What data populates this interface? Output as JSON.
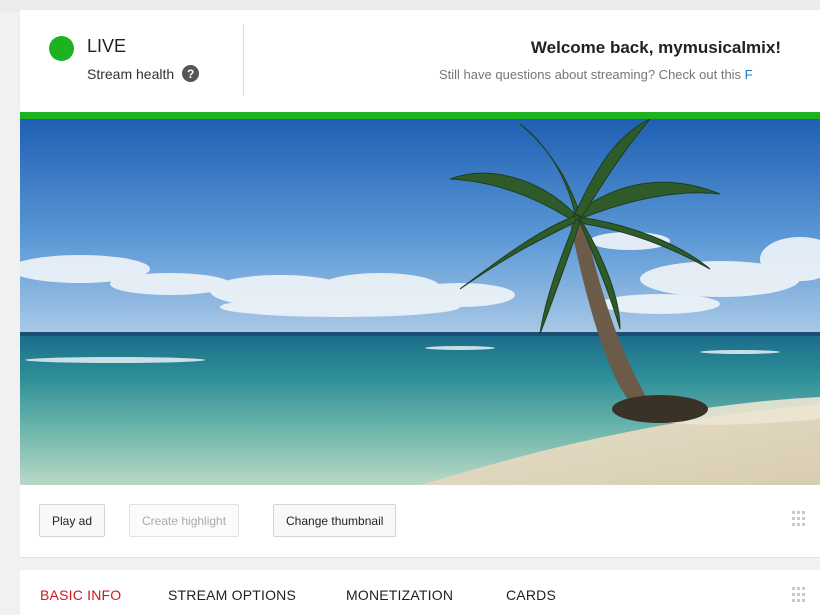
{
  "status": {
    "live_label": "LIVE",
    "health_label": "Stream health",
    "help_icon": "question-mark-icon",
    "status_color": "#1db21f"
  },
  "welcome": {
    "title": "Welcome back, mymusicalmix!",
    "message": "Still have questions about streaming? Check out this ",
    "link_text": "F"
  },
  "video": {
    "scene": "tropical-beach-palm-tree"
  },
  "actions": {
    "play_ad": "Play ad",
    "create_highlight": "Create highlight",
    "change_thumbnail": "Change thumbnail"
  },
  "tabs": [
    {
      "label": "BASIC INFO",
      "active": true
    },
    {
      "label": "STREAM OPTIONS",
      "active": false
    },
    {
      "label": "MONETIZATION",
      "active": false
    },
    {
      "label": "CARDS",
      "active": false
    }
  ],
  "colors": {
    "accent_red": "#cc181e",
    "live_green": "#1db21f",
    "link_blue": "#167ac6"
  }
}
